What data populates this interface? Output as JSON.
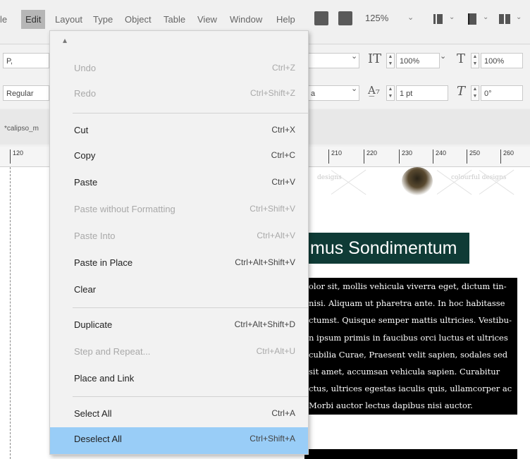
{
  "menubar": {
    "items": [
      "le",
      "Edit",
      "Layout",
      "Type",
      "Object",
      "Table",
      "View",
      "Window",
      "Help"
    ],
    "zoom": "125%"
  },
  "controls": {
    "search": "Ρ,",
    "style": "Regular",
    "leading_pct_1": "100%",
    "leading_pct_2": "100%",
    "tracking": "1 pt",
    "skew": "0°",
    "field_a": "a"
  },
  "document": {
    "tab_name": "*calipso_m",
    "ruler": [
      "120",
      "210",
      "220",
      "230",
      "240",
      "250",
      "260"
    ]
  },
  "edit_menu": {
    "up_arrow": "▴",
    "items": [
      {
        "label": "Undo",
        "shortcut": "Ctrl+Z",
        "enabled": false
      },
      {
        "label": "Redo",
        "shortcut": "Ctrl+Shift+Z",
        "enabled": false
      },
      {
        "label": "Cut",
        "shortcut": "Ctrl+X",
        "enabled": true
      },
      {
        "label": "Copy",
        "shortcut": "Ctrl+C",
        "enabled": true
      },
      {
        "label": "Paste",
        "shortcut": "Ctrl+V",
        "enabled": true
      },
      {
        "label": "Paste without Formatting",
        "shortcut": "Ctrl+Shift+V",
        "enabled": false
      },
      {
        "label": "Paste Into",
        "shortcut": "Ctrl+Alt+V",
        "enabled": false
      },
      {
        "label": "Paste in Place",
        "shortcut": "Ctrl+Alt+Shift+V",
        "enabled": true
      },
      {
        "label": "Clear",
        "shortcut": "",
        "enabled": true
      },
      {
        "label": "Duplicate",
        "shortcut": "Ctrl+Alt+Shift+D",
        "enabled": true
      },
      {
        "label": "Step and Repeat...",
        "shortcut": "Ctrl+Alt+U",
        "enabled": false
      },
      {
        "label": "Place and Link",
        "shortcut": "",
        "enabled": true
      },
      {
        "label": "Select All",
        "shortcut": "Ctrl+A",
        "enabled": true
      },
      {
        "label": "Deselect All",
        "shortcut": "Ctrl+Shift+A",
        "enabled": true,
        "highlighted": true
      }
    ]
  },
  "page": {
    "faint_text_1": "designs",
    "faint_text_2": "colourful designs",
    "heading": "mus Sondimentum",
    "body_lines": [
      "olor sit, mollis vehicula viverra eget, dictum tin-",
      "nisi. Aliquam ut pharetra ante. In hoc habitasse",
      "ctumst. Quisque semper mattis ultricies. Vestibu-",
      "n ipsum primis in faucibus orci luctus et ultrices",
      "cubilia Curae, Praesent velit sapien, sodales sed",
      "sit amet, accumsan vehicula sapien. Curabitur",
      "ctus, ultrices egestas iaculis quis, ullamcorper ac",
      "Morbi auctor lectus dapibus nisi auctor."
    ]
  }
}
